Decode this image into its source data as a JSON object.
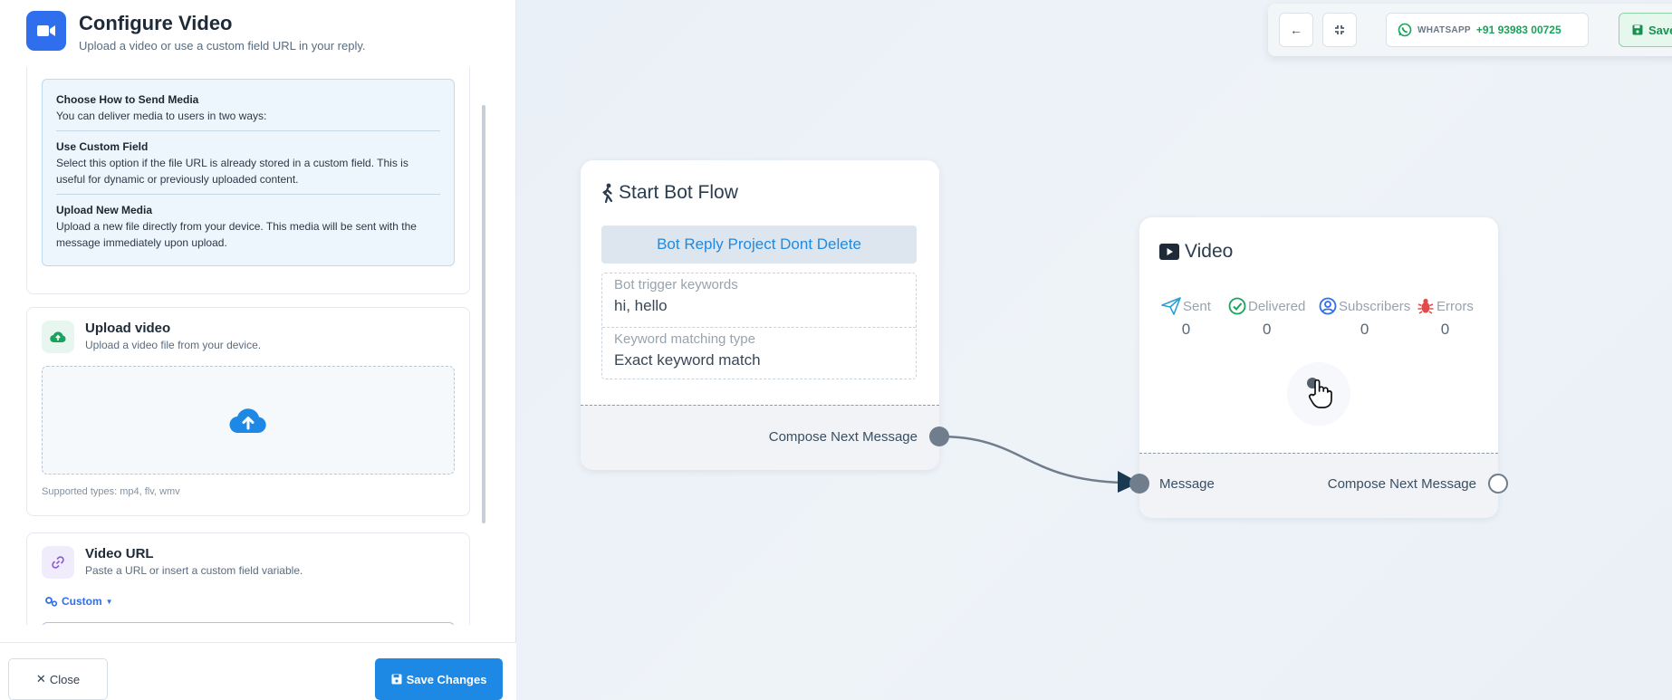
{
  "panel": {
    "title": "Configure Video",
    "subtitle": "Upload a video or use a custom field URL in your reply.",
    "info": {
      "heading1": "Choose How to Send Media",
      "text1": "You can deliver media to users in two ways:",
      "heading2": "Use Custom Field",
      "text2": "Select this option if the file URL is already stored in a custom field. This is useful for dynamic or previously uploaded content.",
      "heading3": "Upload New Media",
      "text3": "Upload a new file directly from your device. This media will be sent with the message immediately upon upload."
    },
    "upload": {
      "title": "Upload video",
      "subtitle": "Upload a video file from your device.",
      "supported": "Supported types: mp4, flv, wmv"
    },
    "video_url": {
      "title": "Video URL",
      "subtitle": "Paste a URL or insert a custom field variable.",
      "custom_label": "Custom"
    },
    "footer": {
      "close_label": "Close",
      "save_label": "Save Changes"
    }
  },
  "toolbar": {
    "whatsapp_label": "WHATSAPP",
    "whatsapp_number": "+91 93983 00725",
    "save_label": "Save"
  },
  "start_node": {
    "title": "Start Bot Flow",
    "project": "Bot Reply Project Dont Delete",
    "keywords_label": "Bot trigger keywords",
    "keywords_value": "hi, hello",
    "matching_label": "Keyword matching type",
    "matching_value": "Exact keyword match",
    "next_label": "Compose Next Message"
  },
  "video_node": {
    "title": "Video",
    "stats": [
      {
        "label": "Sent",
        "value": "0"
      },
      {
        "label": "Delivered",
        "value": "0"
      },
      {
        "label": "Subscribers",
        "value": "0"
      },
      {
        "label": "Errors",
        "value": "0"
      }
    ],
    "input_label": "Message",
    "next_label": "Compose Next Message"
  },
  "colors": {
    "primary": "#2f6fed",
    "save_blue": "#1e88e5",
    "whatsapp_green": "#17a35a",
    "project_blue": "#1f8ae0",
    "error_red": "#e24b4b"
  }
}
